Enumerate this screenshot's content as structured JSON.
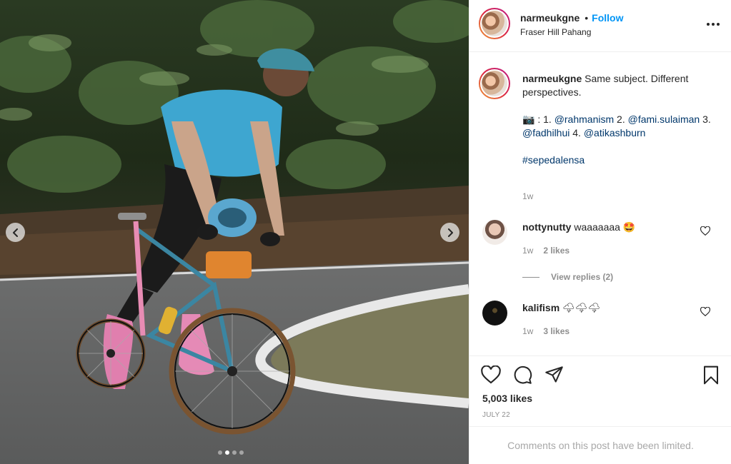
{
  "post": {
    "username": "narmeukgne",
    "separator": "•",
    "follow_label": "Follow",
    "location": "Fraser Hill Pahang"
  },
  "caption": {
    "username": "narmeukgne",
    "text": "Same subject. Different perspectives.",
    "camera_emoji": "📷",
    "line2_prefix": ": 1.",
    "mention1": "@rahmanism",
    "sep2": "2.",
    "mention2": "@fami.sulaiman",
    "sep3": "3.",
    "mention3": "@fadhilhui",
    "sep4": "4.",
    "mention4": "@atikashburn",
    "hashtag": "#sepedalensa",
    "age": "1w"
  },
  "comments": [
    {
      "username": "nottynutty",
      "text": "waaaaaaa 🤩",
      "age": "1w",
      "likes": "2 likes",
      "view_replies": "View replies (2)"
    },
    {
      "username": "kalifism",
      "text": "🌩🌩🌩",
      "age": "1w",
      "likes": "3 likes"
    }
  ],
  "stats": {
    "likes": "5,003 likes",
    "date": "JULY 22"
  },
  "footer": {
    "limited_text": "Comments on this post have been limited."
  },
  "carousel": {
    "total": 4,
    "active_index": 1
  },
  "icons": {
    "more": "more-options-icon",
    "like": "heart-icon",
    "comment": "comment-icon",
    "share": "share-icon",
    "save": "bookmark-icon",
    "prev": "chevron-left-icon",
    "next": "chevron-right-icon"
  },
  "colors": {
    "accent": "#0095f6",
    "link": "#00376b",
    "muted": "#8e8e8e"
  }
}
